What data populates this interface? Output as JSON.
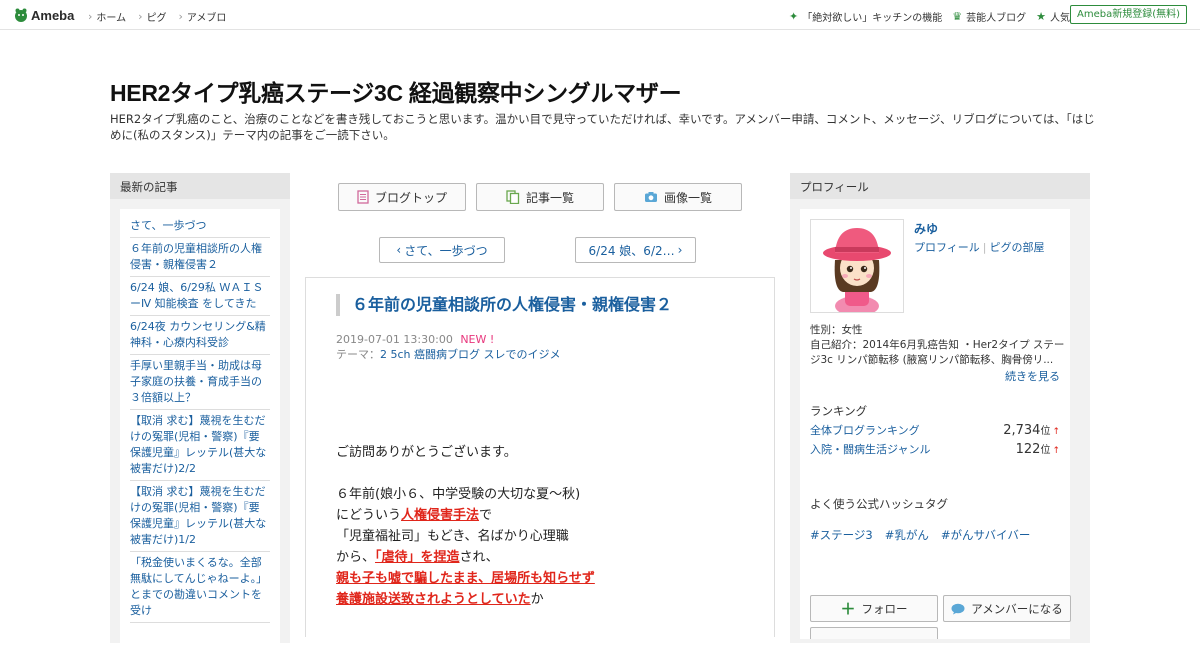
{
  "topbar": {
    "logo": "Ameba",
    "nav": [
      "ホーム",
      "ピグ",
      "アメブロ"
    ],
    "right_links": [
      {
        "label": "「絶対欲しい」キッチンの機能",
        "icon": "sparkle-icon"
      },
      {
        "label": "芸能人ブログ",
        "icon": "crown-icon"
      },
      {
        "label": "人気ブログ",
        "icon": "star-icon"
      }
    ],
    "signup": "Ameba新規登録(無料)"
  },
  "blog": {
    "title": "HER2タイプ乳癌ステージ3C 経過観察中シングルマザー",
    "description": "HER2タイプ乳癌のこと、治療のことなどを書き残しておこうと思います。温かい目で見守っていただければ、幸いです。アメンバー申請、コメント、メッセージ、リブログについては、「はじめに(私のスタンス)」テーマ内の記事をご一読下さい。"
  },
  "sidebar_left": {
    "heading": "最新の記事",
    "items": [
      "さて、一歩づつ",
      "６年前の児童相談所の人権侵害・親権侵害２",
      "6/24 娘、6/29私 ＷＡＩＳーⅣ 知能検査 をしてきた",
      "6/24夜 カウンセリング&精神科・心療内科受診",
      "手厚い里親手当・助成は母子家庭の扶養・育成手当の３倍額以上？",
      "【取消 求む】蔑視を生むだけの冤罪(児相・警察)『要保護児童』レッテル(甚大な被害だけ)2/2",
      "【取消 求む】蔑視を生むだけの冤罪(児相・警察)『要保護児童』レッテル(甚大な被害だけ)1/2",
      "「税金使いまくるな。全部無駄にしてんじゃねーよ。」とまでの勘違いコメントを受け"
    ]
  },
  "center": {
    "buttons": [
      {
        "label": "ブログトップ",
        "icon": "document-icon"
      },
      {
        "label": "記事一覧",
        "icon": "copy-icon"
      },
      {
        "label": "画像一覧",
        "icon": "camera-icon"
      }
    ],
    "prev_label": "さて、一歩づつ",
    "next_label": "6/24 娘、6/2…",
    "article": {
      "title": "６年前の児童相談所の人権侵害・親権侵害２",
      "date": "2019-07-01 13:30:00",
      "new_badge": "NEW !",
      "theme_label": "テーマ：",
      "theme": "2 5ch 癌闘病ブログ スレでのイジメ",
      "body": {
        "p1": "ご訪問ありがとうございます。",
        "l1": "６年前(娘小６、中学受験の大切な夏～秋)",
        "l2a": "にどういう",
        "l2b": "人権侵害手法",
        "l2c": "で",
        "l3": "「児童福祉司」もどき、名ばかり心理職",
        "l4a": "から、",
        "l4b": "「虐待」を捏造",
        "l4c": "され、",
        "l5": "親も子も嘘で騙したまま、居場所も知らせず",
        "l6a": "養護施設送致されようとしていた",
        "l6b": "か"
      }
    }
  },
  "sidebar_right": {
    "heading": "プロフィール",
    "name": "みゆ",
    "link_profile": "プロフィール",
    "link_room": "ピグの部屋",
    "gender": "性別：女性",
    "intro": "自己紹介：2014年6月乳癌告知 ・Her2タイプ ステージ3c リンパ節転移 (腋窩リンパ節転移、胸骨傍リ...",
    "more": "続きを見る",
    "ranking_heading": "ランキング",
    "rankings": [
      {
        "label": "全体ブログランキング",
        "value": "2,734",
        "unit": "位",
        "trend": "↑"
      },
      {
        "label": "入院・闘病生活ジャンル",
        "value": "122",
        "unit": "位",
        "trend": "↑"
      }
    ],
    "hashtag_heading": "よく使う公式ハッシュタグ",
    "hashtags": [
      "#ステージ3",
      "#乳がん",
      "#がんサバイバー"
    ],
    "follow": "フォロー",
    "amember": "アメンバーになる"
  }
}
